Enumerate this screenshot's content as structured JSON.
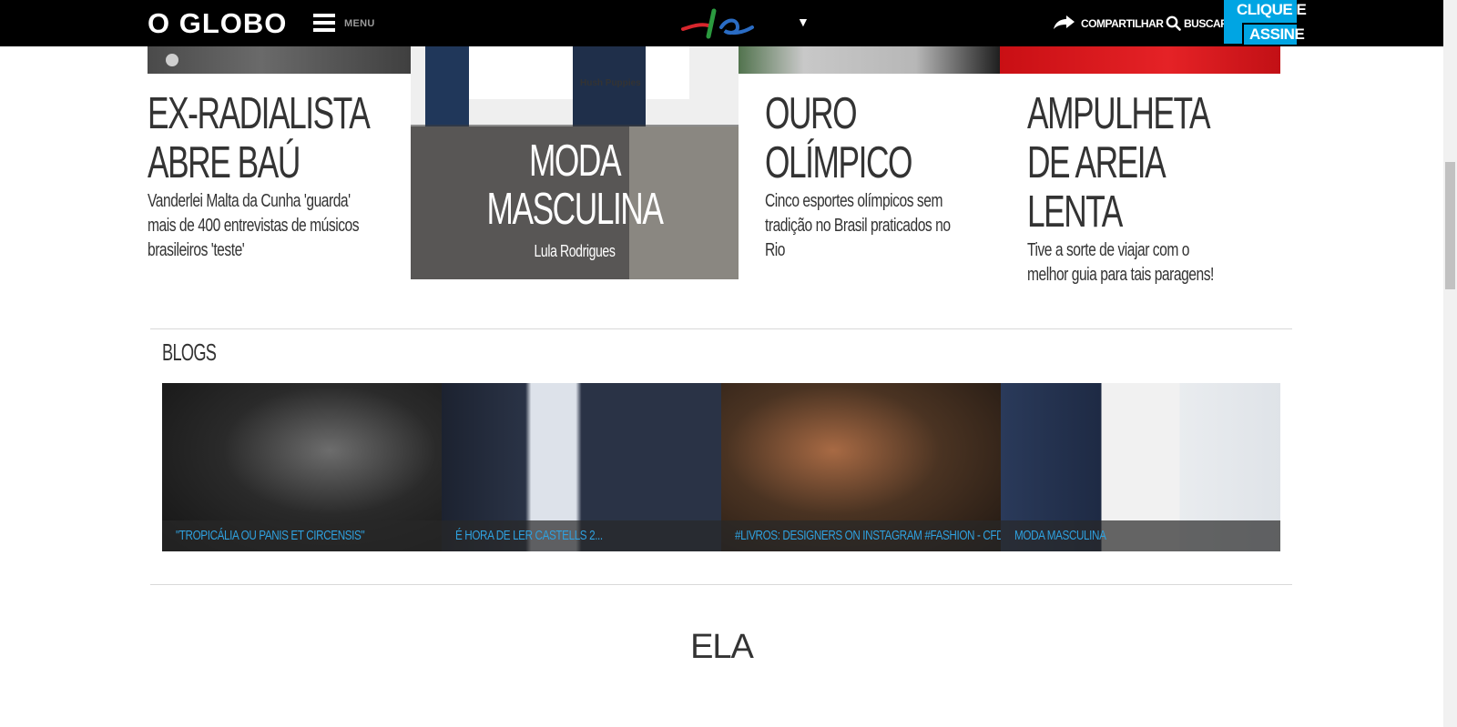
{
  "header": {
    "logo": "O GLOBO",
    "menu_label": "MENU",
    "section_logo_icon": "ela-logo-icon",
    "share_label": "COMPARTILHAR",
    "search_label": "BUSCAR",
    "subscribe_top": "CLIQUE E",
    "subscribe_bottom": "ASSINE",
    "colors": {
      "bar": "#000000",
      "accent": "#00a5e3"
    }
  },
  "articles": [
    {
      "title_line1": "EX-RADIALISTA",
      "title_line2": "ABRE BAÚ",
      "description": "Vanderlei Malta da Cunha 'guarda' mais de 400 entrevistas de músicos brasileiros 'teste'"
    },
    {
      "title": "MODA\nMASCULINA",
      "author": "Lula Rodrigues",
      "brand": "Hush Puppies"
    },
    {
      "title_line1": "OURO",
      "title_line2": "OLÍMPICO",
      "description": "Cinco esportes olímpicos sem tradição no Brasil praticados no Rio"
    },
    {
      "title_line1": "AMPULHETA",
      "title_line2": "DE AREIA",
      "title_line3": "LENTA",
      "description": "Tive a sorte de viajar com o melhor guia para tais paragens!"
    }
  ],
  "blogs": {
    "heading": "BLOGS",
    "items": [
      {
        "caption": "\"TROPICÁLIA OU PANIS ET CIRCENSIS\""
      },
      {
        "caption": "É HORA DE LER CASTELLS 2..."
      },
      {
        "caption": "#LIVROS: DESIGNERS ON INSTAGRAM #FASHION - CFDA"
      },
      {
        "caption": "MODA MASCULINA"
      }
    ],
    "caption_color": "#2fa1df"
  },
  "section_heading": "ELA"
}
